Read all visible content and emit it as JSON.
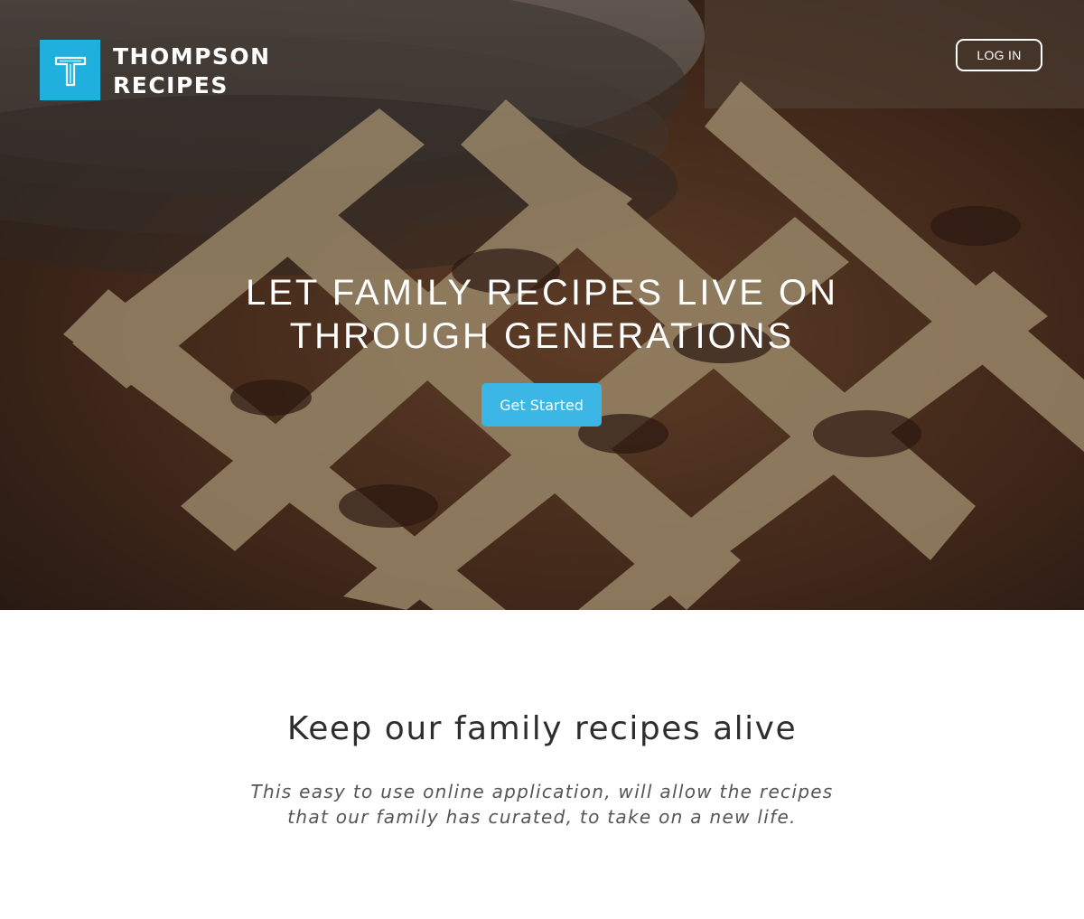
{
  "brand": {
    "name_line1": "THOMPSON",
    "name_line2": "RECIPES",
    "accent_color": "#1fb0de",
    "logo_icon": "letter-t-logo-icon"
  },
  "header": {
    "login_label": "LOG IN"
  },
  "hero": {
    "title_line1": "LET FAMILY RECIPES LIVE ON",
    "title_line2": "THROUGH GENERATIONS",
    "cta_label": "Get Started",
    "cta_color": "#3cb6e4",
    "background_image": "lattice-pie-photo"
  },
  "intro": {
    "title": "Keep our family recipes alive",
    "text_line1": "This easy to use online application, will allow the recipes",
    "text_line2": "that our family has curated, to take on a new life."
  }
}
